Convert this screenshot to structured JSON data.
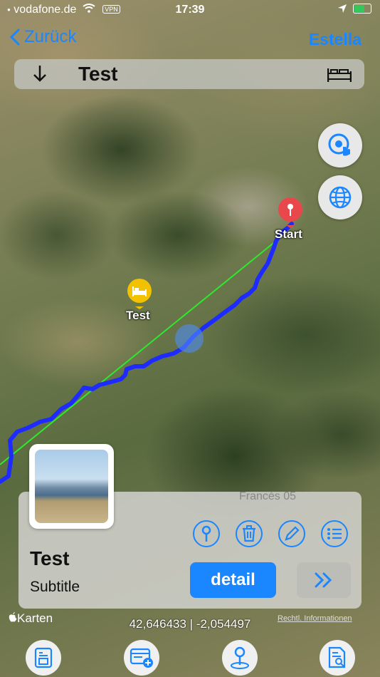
{
  "status_bar": {
    "carrier": "vodafone.de",
    "vpn": "VPN",
    "time": "17:39"
  },
  "nav": {
    "back_label": "Zurück",
    "right_label": "Estella"
  },
  "title_bar": {
    "title": "Test",
    "left_icon": "arrow-down-icon",
    "right_icon": "bed-icon"
  },
  "map": {
    "pins": [
      {
        "label": "Start",
        "color": "#e8474c",
        "icon": "pin-icon"
      },
      {
        "label": "Test",
        "color": "#f2c200",
        "icon": "bed-icon"
      }
    ],
    "route_color": "#1e2bff",
    "line_color": "#2ee82e",
    "attribution": "Karten",
    "legal": "Rechtl. Informationen",
    "coordinates": "42,646433 | -2,054497"
  },
  "card": {
    "faded_title": "Francés 05",
    "name": "Test",
    "subtitle": "Subtitle",
    "detail_label": "detail",
    "accent": "#1a86ff"
  }
}
